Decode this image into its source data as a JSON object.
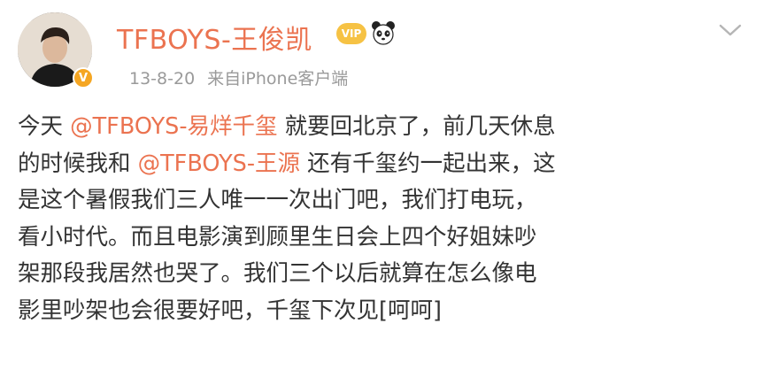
{
  "post": {
    "username": "TFBOYS-王俊凯",
    "timestamp": "13-8-20",
    "source": "来自iPhone客户端",
    "verified_badge": "V",
    "member_badge": "VIP",
    "icons": [
      "member-badge-icon",
      "panda-emoji-icon",
      "chevron-down-icon",
      "verified-icon"
    ],
    "accent_color": "#eb7350",
    "lines": [
      {
        "pre": "今天 ",
        "mention": "@TFBOYS-易烊千玺",
        "post": " 就要回北京了，前几天休息"
      },
      {
        "pre": "的时候我和 ",
        "mention": "@TFBOYS-王源",
        "post": " 还有千玺约一起出来，这"
      },
      {
        "pre": "是这个暑假我们三人唯一一次出门吧，我们打电玩，",
        "mention": "",
        "post": ""
      },
      {
        "pre": "看小时代。而且电影演到顾里生日会上四个好姐妹吵",
        "mention": "",
        "post": ""
      },
      {
        "pre": "架那段我居然也哭了。我们三个以后就算在怎么像电",
        "mention": "",
        "post": ""
      },
      {
        "pre": "影里吵架也会很要好吧，千玺下次见[呵呵]",
        "mention": "",
        "post": ""
      }
    ]
  }
}
